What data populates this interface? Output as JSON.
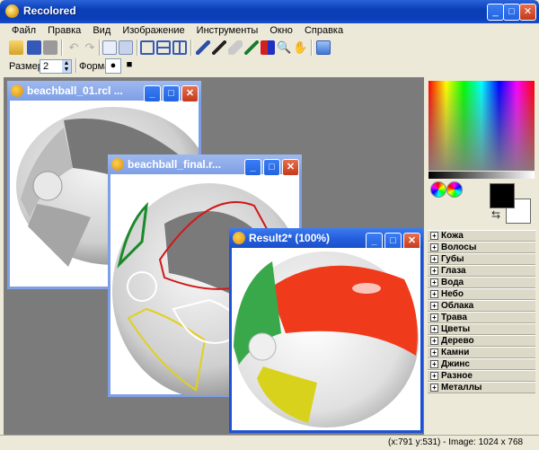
{
  "app": {
    "title": "Recolored",
    "window_buttons": [
      "minimize",
      "maximize",
      "close"
    ]
  },
  "menu": [
    "Файл",
    "Правка",
    "Вид",
    "Изображение",
    "Инструменты",
    "Окно",
    "Справка"
  ],
  "toolbar": {
    "icons": [
      "open-icon",
      "save-icon",
      "print-icon",
      "undo-icon",
      "redo-icon",
      "copy-icon",
      "paste-icon",
      "layout-icon",
      "tile-horizontal-icon",
      "tile-vertical-icon",
      "brush-icon",
      "pen-icon",
      "eraser-icon",
      "eyedropper-icon",
      "fill-icon",
      "zoom-icon",
      "hand-icon",
      "export-icon"
    ]
  },
  "options": {
    "size_label": "Размер",
    "size_value": "2",
    "shape_label": "Форма",
    "shape_options": [
      "●",
      "■"
    ]
  },
  "documents": [
    {
      "title": "beachball_01.rcl ...",
      "active": false
    },
    {
      "title": "beachball_final.r...",
      "active": false
    },
    {
      "title": "Result2* (100%)",
      "active": true
    }
  ],
  "colors": {
    "foreground": "#000000",
    "background": "#ffffff",
    "title_active": "#2460dc",
    "title_inactive": "#7e9fe6",
    "workspace": "#7b7b7b"
  },
  "palette_categories": [
    "Кожа",
    "Волосы",
    "Губы",
    "Глаза",
    "Вода",
    "Небо",
    "Облака",
    "Трава",
    "Цветы",
    "Дерево",
    "Камни",
    "Джинс",
    "Разное",
    "Металлы"
  ],
  "status": "(x:791 y:531) - Image: 1024 x 768"
}
